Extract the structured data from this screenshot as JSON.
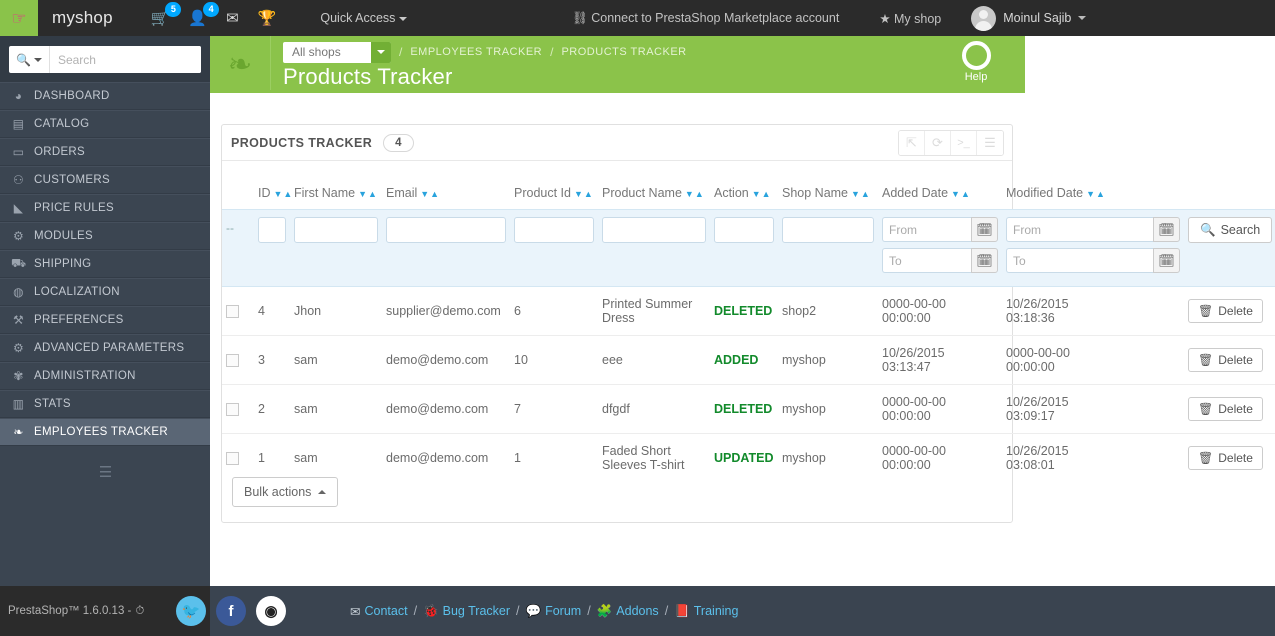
{
  "topbar": {
    "shop_name": "myshop",
    "cart_badge": "5",
    "customer_badge": "4",
    "quick_access": "Quick Access",
    "marketplace": "Connect to PrestaShop Marketplace account",
    "my_shop": "My shop",
    "employee_name": "Moinul Sajib"
  },
  "sidebar": {
    "search_placeholder": "Search",
    "items": [
      {
        "label": "DASHBOARD",
        "icon": "dashboard-icon",
        "glyph": "◕",
        "active": false
      },
      {
        "label": "CATALOG",
        "icon": "book-icon",
        "glyph": "▤",
        "active": false
      },
      {
        "label": "ORDERS",
        "icon": "card-icon",
        "glyph": "▭",
        "active": false
      },
      {
        "label": "CUSTOMERS",
        "icon": "people-icon",
        "glyph": "⚇",
        "active": false
      },
      {
        "label": "PRICE RULES",
        "icon": "tag-icon",
        "glyph": "◣",
        "active": false
      },
      {
        "label": "MODULES",
        "icon": "plug-icon",
        "glyph": "⚙",
        "active": false
      },
      {
        "label": "SHIPPING",
        "icon": "truck-icon",
        "glyph": "⛟",
        "active": false
      },
      {
        "label": "LOCALIZATION",
        "icon": "globe-icon",
        "glyph": "◍",
        "active": false
      },
      {
        "label": "PREFERENCES",
        "icon": "wrench-icon",
        "glyph": "⚒",
        "active": false
      },
      {
        "label": "ADVANCED PARAMETERS",
        "icon": "gears-icon",
        "glyph": "⚙",
        "active": false
      },
      {
        "label": "ADMINISTRATION",
        "icon": "gear-icon",
        "glyph": "✾",
        "active": false
      },
      {
        "label": "STATS",
        "icon": "chart-icon",
        "glyph": "▥",
        "active": false
      },
      {
        "label": "EMPLOYEES TRACKER",
        "icon": "leaf-icon",
        "glyph": "❧",
        "active": true
      }
    ]
  },
  "page_header": {
    "shop_selector_value": "All shops",
    "breadcrumb": [
      "EMPLOYEES TRACKER",
      "PRODUCTS TRACKER"
    ],
    "title": "Products Tracker",
    "help_label": "Help"
  },
  "panel": {
    "title": "PRODUCTS TRACKER",
    "count": "4",
    "tools": [
      {
        "name": "export-icon",
        "glyph": "⇱"
      },
      {
        "name": "refresh-icon",
        "glyph": "⟳"
      },
      {
        "name": "console-icon",
        "glyph": ">_"
      },
      {
        "name": "database-icon",
        "glyph": "☰"
      }
    ]
  },
  "table": {
    "columns": [
      "ID",
      "First Name",
      "Email",
      "Product Id",
      "Product Name",
      "Action",
      "Shop Name",
      "Added Date",
      "Modified Date"
    ],
    "filters": {
      "id": "",
      "first_name": "",
      "email": "",
      "product_id": "",
      "product_name": "",
      "action": "",
      "shop_name": "",
      "added_from_placeholder": "From",
      "added_to_placeholder": "To",
      "modified_from_placeholder": "From",
      "modified_to_placeholder": "To",
      "added_from": "",
      "added_to": "",
      "modified_from": "",
      "modified_to": "",
      "search_label": "Search",
      "dash": "--"
    },
    "rows": [
      {
        "id": "4",
        "first_name": "Jhon",
        "email": "supplier@demo.com",
        "product_id": "6",
        "product_name": "Printed Summer Dress",
        "action": "DELETED",
        "shop_name": "shop2",
        "added_date": "0000-00-00 00:00:00",
        "modified_date": "10/26/2015 03:18:36",
        "delete_label": "Delete"
      },
      {
        "id": "3",
        "first_name": "sam",
        "email": "demo@demo.com",
        "product_id": "10",
        "product_name": "eee",
        "action": "ADDED",
        "shop_name": "myshop",
        "added_date": "10/26/2015 03:13:47",
        "modified_date": "0000-00-00 00:00:00",
        "delete_label": "Delete"
      },
      {
        "id": "2",
        "first_name": "sam",
        "email": "demo@demo.com",
        "product_id": "7",
        "product_name": "dfgdf",
        "action": "DELETED",
        "shop_name": "myshop",
        "added_date": "0000-00-00 00:00:00",
        "modified_date": "10/26/2015 03:09:17",
        "delete_label": "Delete"
      },
      {
        "id": "1",
        "first_name": "sam",
        "email": "demo@demo.com",
        "product_id": "1",
        "product_name": "Faded Short Sleeves T-shirt",
        "action": "UPDATED",
        "shop_name": "myshop",
        "added_date": "0000-00-00 00:00:00",
        "modified_date": "10/26/2015 03:08:01",
        "delete_label": "Delete"
      }
    ]
  },
  "bulk_actions_label": "Bulk actions",
  "footer": {
    "version": "PrestaShop™ 1.6.0.13 -",
    "socials": [
      {
        "name": "twitter-icon",
        "glyph": "🐦",
        "color": "#5bc0eb"
      },
      {
        "name": "facebook-icon",
        "glyph": "f",
        "color": "#3b5998"
      },
      {
        "name": "github-icon",
        "glyph": "◉",
        "color": "#ffffff"
      }
    ],
    "links": [
      "Contact",
      "Bug Tracker",
      "Forum",
      "Addons",
      "Training"
    ]
  },
  "colors": {
    "brand_green": "#8bc34a",
    "action_green": "#128a2b",
    "sort_blue": "#29a3dd",
    "badge_blue": "#00a8ff",
    "filter_row_bg": "#eaf4fb"
  }
}
